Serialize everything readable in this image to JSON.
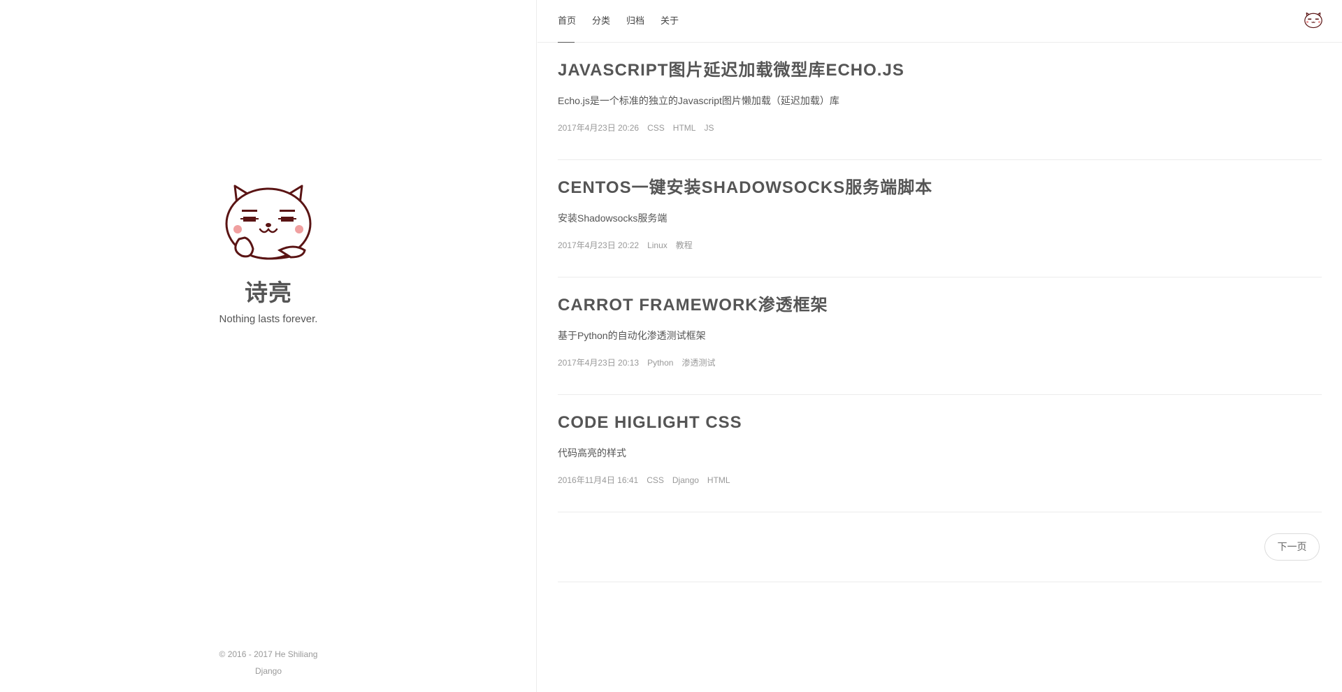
{
  "sidebar": {
    "author_name": "诗亮",
    "motto": "Nothing lasts forever.",
    "footer": {
      "copyright": "© 2016 - 2017 He Shiliang",
      "powered_by": "Django"
    },
    "avatar_icon": "cat-avatar-icon"
  },
  "nav": {
    "items": [
      {
        "label": "首页",
        "active": true
      },
      {
        "label": "分类",
        "active": false
      },
      {
        "label": "归档",
        "active": false
      },
      {
        "label": "关于",
        "active": false
      }
    ],
    "avatar_icon": "cat-avatar-icon"
  },
  "posts": [
    {
      "title": "Javascript图片延迟加载微型库Echo.js",
      "excerpt": "Echo.js是一个标准的独立的Javascript图片懒加载（延迟加载）库",
      "date": "2017年4月23日 20:26",
      "tags": [
        "CSS",
        "HTML",
        "JS"
      ]
    },
    {
      "title": "CentOS一键安装Shadowsocks服务端脚本",
      "excerpt": "安装Shadowsocks服务端",
      "date": "2017年4月23日 20:22",
      "tags": [
        "Linux",
        "教程"
      ]
    },
    {
      "title": "Carrot Framework渗透框架",
      "excerpt": "基于Python的自动化渗透测试框架",
      "date": "2017年4月23日 20:13",
      "tags": [
        "Python",
        "渗透测试"
      ]
    },
    {
      "title": "Code higlight CSS",
      "excerpt": "代码高亮的样式",
      "date": "2016年11月4日 16:41",
      "tags": [
        "CSS",
        "Django",
        "HTML"
      ]
    }
  ],
  "pager": {
    "next_label": "下一页"
  },
  "colors": {
    "text": "#555555",
    "meta": "#999999",
    "divider": "#ececec",
    "cat_outline": "#5a1414",
    "cat_blush": "#f0a0a0"
  }
}
